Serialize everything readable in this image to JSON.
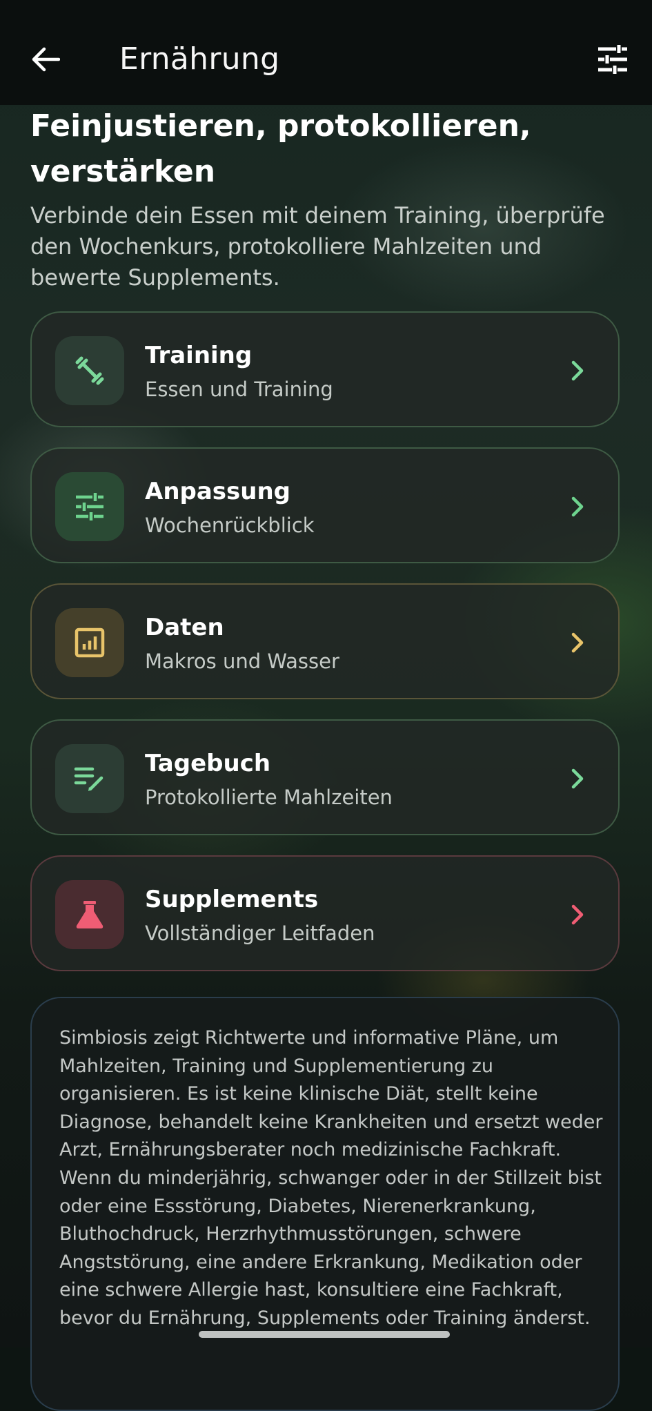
{
  "header": {
    "title": "Ernährung",
    "back_icon": "arrow-left-icon",
    "filter_icon": "tune-sliders-icon"
  },
  "hero": {
    "heading": "Feinjustieren, protokollieren, verstärken",
    "intro": "Verbinde dein Essen mit deinem Training, überprüfe den Wochenkurs, protokolliere Mahlzeiten und bewerte Supplements."
  },
  "cards": [
    {
      "title": "Training",
      "subtitle": "Essen und Training",
      "icon": "dumbbell-icon",
      "accent": "#7bd99a",
      "border": "#3e5a44",
      "icon_bg": "#2c3d34"
    },
    {
      "title": "Anpassung",
      "subtitle": "Wochenrückblick",
      "icon": "tune-sliders-icon",
      "accent": "#6ed38e",
      "border": "#3e5a44",
      "icon_bg": "#2a4a34"
    },
    {
      "title": "Daten",
      "subtitle": "Makros und Wasser",
      "icon": "bar-chart-icon",
      "accent": "#e8c46a",
      "border": "#5a5538",
      "icon_bg": "#45402a"
    },
    {
      "title": "Tagebuch",
      "subtitle": "Protokollierte Mahlzeiten",
      "icon": "edit-list-icon",
      "accent": "#7bd99a",
      "border": "#3e5a44",
      "icon_bg": "#2c3d34"
    },
    {
      "title": "Supplements",
      "subtitle": "Vollständiger Leitfaden",
      "icon": "flask-icon",
      "accent": "#ef5d74",
      "border": "#5a3a3e",
      "icon_bg": "#4a2c30"
    }
  ],
  "disclaimer": {
    "text": "Simbiosis zeigt Richtwerte und informative Pläne, um Mahlzeiten, Training und Supplementierung zu organisieren. Es ist keine klinische Diät, stellt keine Diagnose, behandelt keine Krankheiten und ersetzt weder Arzt, Ernährungsberater noch medizinische Fachkraft. Wenn du minderjährig, schwanger oder in der Stillzeit bist oder eine Essstörung, Diabetes, Nierenerkrankung, Bluthochdruck, Herzrhythmusstörungen, schwere Angststörung, eine andere Erkrankung, Medikation oder eine schwere Allergie hast, konsultiere eine Fachkraft, bevor du Ernährung, Supplements oder Training änderst."
  }
}
